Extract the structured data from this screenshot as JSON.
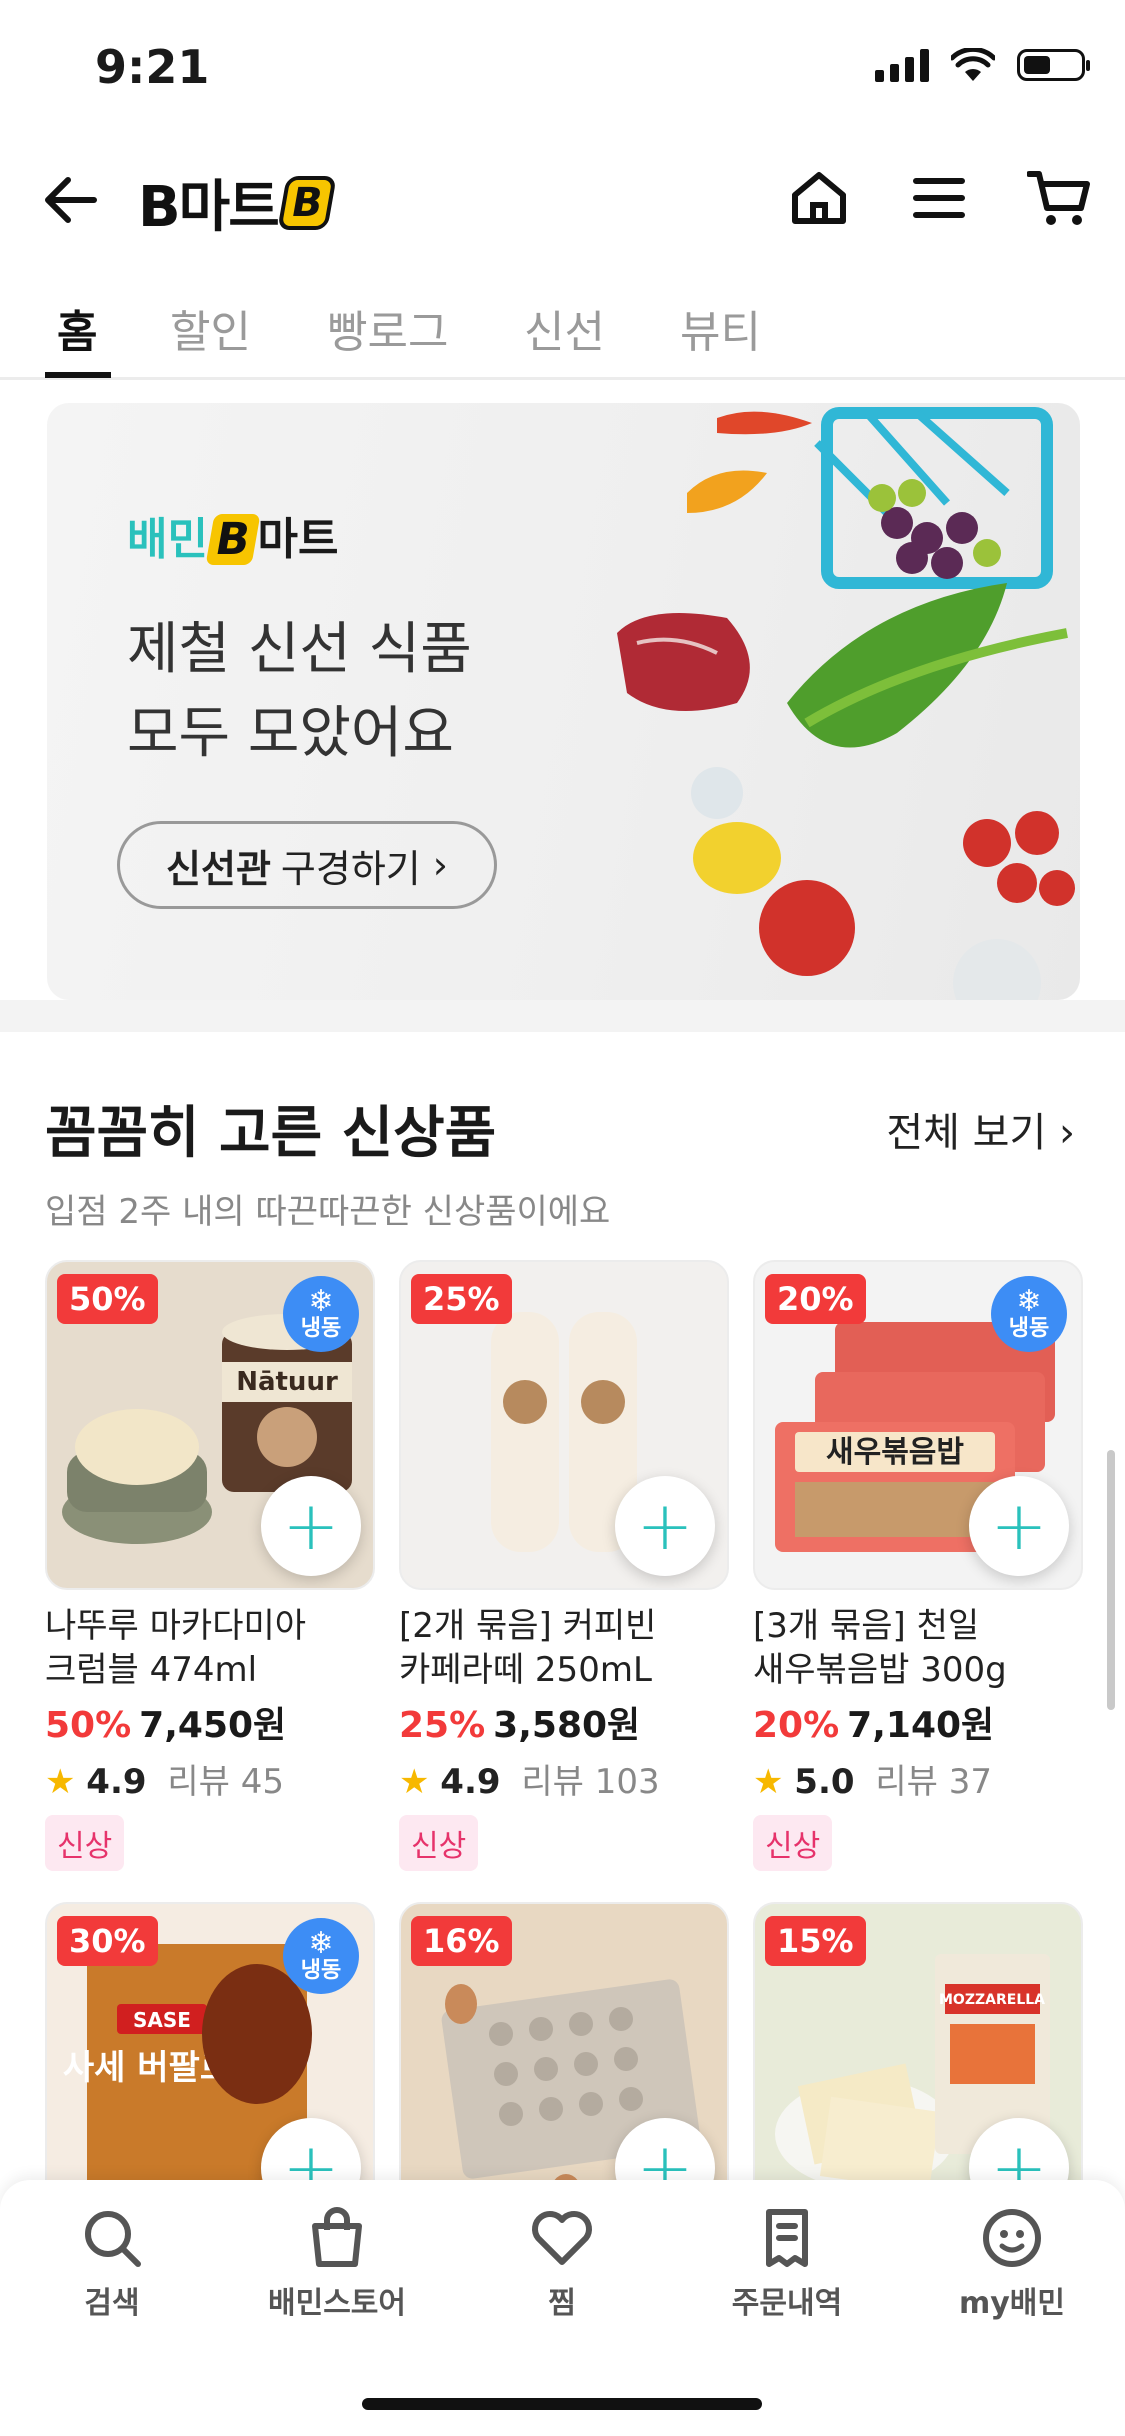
{
  "status": {
    "time": "9:21"
  },
  "header": {
    "logo_text": "B마트",
    "logo_mark": "B"
  },
  "tabs": [
    "홈",
    "할인",
    "빵로그",
    "신선",
    "뷰티"
  ],
  "banner": {
    "brand_a": "배민",
    "brand_b": "B",
    "brand_c": "마트",
    "title_line1": "제철 신선 식품",
    "title_line2": "모두 모았어요",
    "cta_bold": "신선관",
    "cta_rest": "구경하기",
    "cta_chevron": "›"
  },
  "section": {
    "title": "꼼꼼히 고른 신상품",
    "see_all": "전체 보기 ›",
    "subtitle": "입점 2주 내의 따끈따끈한 신상품이에요"
  },
  "products": [
    {
      "discount": "50%",
      "frozen": true,
      "name_line1": "나뚜루 마카다미아",
      "name_line2": "크럼블 474ml",
      "pct": "50%",
      "price": "7,450원",
      "rating": "4.9",
      "reviews": "리뷰 45",
      "badge": "신상"
    },
    {
      "discount": "25%",
      "frozen": false,
      "name_line1": "[2개 묶음] 커피빈",
      "name_line2": "카페라떼 250mL",
      "pct": "25%",
      "price": "3,580원",
      "rating": "4.9",
      "reviews": "리뷰 103",
      "badge": "신상"
    },
    {
      "discount": "20%",
      "frozen": true,
      "name_line1": "[3개 묶음] 천일",
      "name_line2": "새우볶음밥 300g",
      "pct": "20%",
      "price": "7,140원",
      "rating": "5.0",
      "reviews": "리뷰 37",
      "badge": "신상"
    },
    {
      "discount": "30%",
      "frozen": true
    },
    {
      "discount": "16%",
      "frozen": false
    },
    {
      "discount": "15%",
      "frozen": false
    }
  ],
  "frozen_label": "냉동",
  "frozen_symbol": "❄",
  "add_symbol": "+",
  "star": "★",
  "image_text": {
    "icecream_brand": "Nātuur",
    "rice_label": "새우볶음밥",
    "sauce_brand": "SASE",
    "sauce_name": "사세 버팔로",
    "cheese_label": "MOZZARELLA"
  },
  "bottom_nav": [
    "검색",
    "배민스토어",
    "찜",
    "주문내역",
    "my배민"
  ]
}
